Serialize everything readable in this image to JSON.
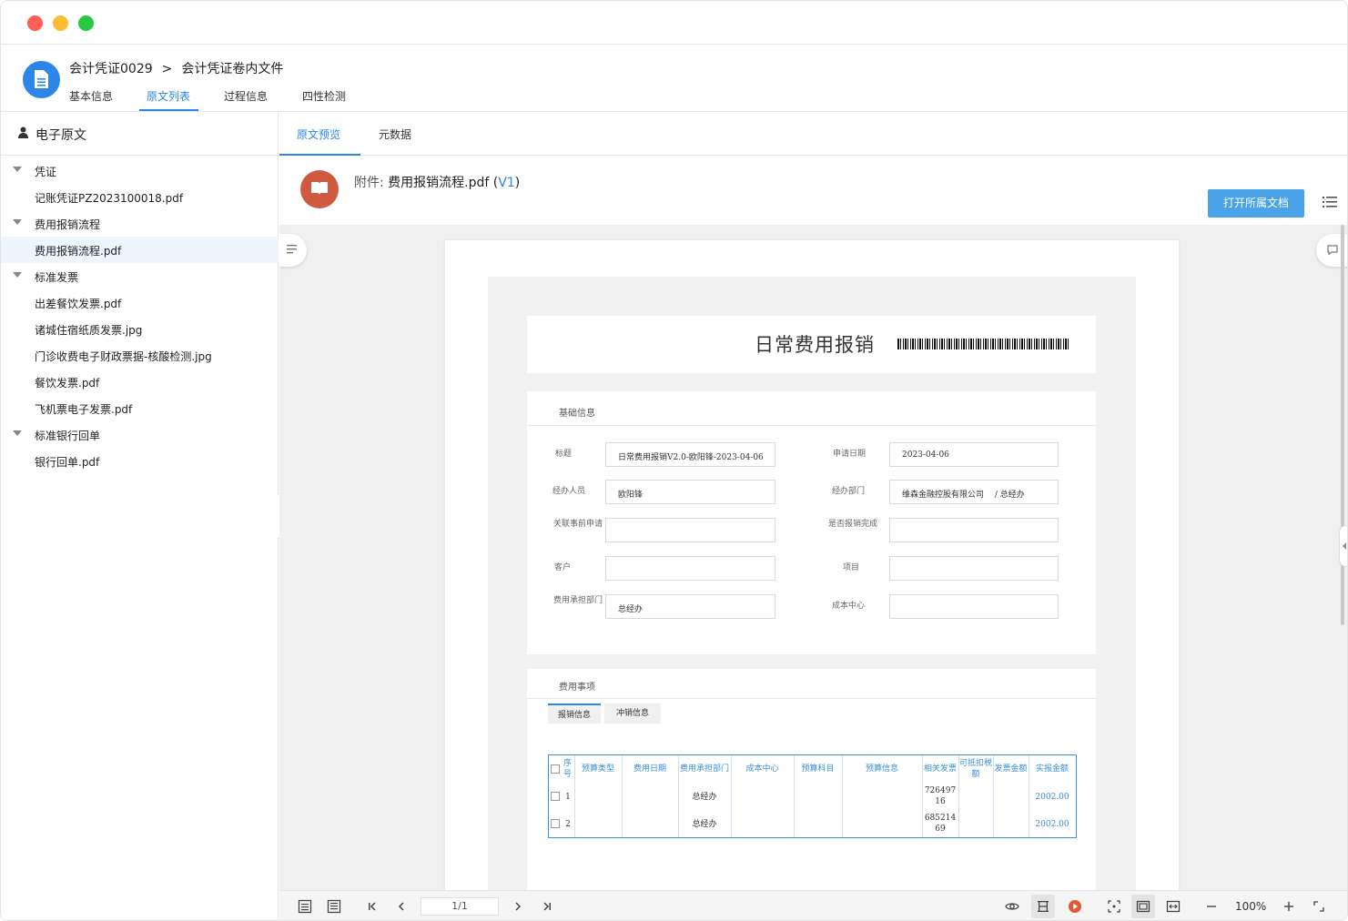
{
  "header": {
    "breadcrumb": [
      "会计凭证0029",
      ">",
      "会计凭证卷内文件"
    ],
    "tabs": [
      "基本信息",
      "原文列表",
      "过程信息",
      "四性检测"
    ],
    "active_tab": "原文列表"
  },
  "sidebar": {
    "title": "电子原文",
    "tree": [
      {
        "label": "凭证",
        "type": "group"
      },
      {
        "label": "记账凭证PZ2023100018.pdf",
        "type": "file"
      },
      {
        "label": "费用报销流程",
        "type": "group"
      },
      {
        "label": "费用报销流程.pdf",
        "type": "file",
        "selected": true
      },
      {
        "label": "标准发票",
        "type": "group"
      },
      {
        "label": "出差餐饮发票.pdf",
        "type": "file"
      },
      {
        "label": "诸城住宿纸质发票.jpg",
        "type": "file"
      },
      {
        "label": "门诊收费电子财政票据-核酸检测.jpg",
        "type": "file"
      },
      {
        "label": "餐饮发票.pdf",
        "type": "file"
      },
      {
        "label": "飞机票电子发票.pdf",
        "type": "file"
      },
      {
        "label": "标准银行回单",
        "type": "group"
      },
      {
        "label": "银行回单.pdf",
        "type": "file"
      }
    ]
  },
  "main": {
    "tabs": [
      "原文预览",
      "元数据"
    ],
    "active_tab": "原文预览",
    "attachment": {
      "prefix": "附件:",
      "name": "费用报销流程.pdf",
      "paren_open": " (",
      "version": "V1",
      "paren_close": ")"
    },
    "open_button": "打开所属文档"
  },
  "document": {
    "title": "日常费用报销",
    "basic_section": "基础信息",
    "fields": {
      "title_label": "标题",
      "title_value": "日常费用报销V2.0-欧阳锋-2023-04-06",
      "apply_date_label": "申请日期",
      "apply_date_value": "2023-04-06",
      "handler_label": "经办人员",
      "handler_value": "欧阳锋",
      "dept_label": "经办部门",
      "dept_value": "维森金融控股有限公司　 / 总经办",
      "pre_app_label": "关联事前申请",
      "reimb_done_label": "是否报销完成",
      "customer_label": "客户",
      "project_label": "项目",
      "bear_dept_label": "费用承担部门",
      "bear_dept_value": "总经办",
      "cost_center_label": "成本中心"
    },
    "expense_section": "费用事项",
    "sub_tabs": [
      "报销信息",
      "冲销信息"
    ],
    "table_headers": [
      "序号",
      "预算类型",
      "费用日期",
      "费用承担部门",
      "成本中心",
      "预算科目",
      "预算信息",
      "相关发票",
      "可抵扣税额",
      "发票金额",
      "实报金额"
    ],
    "rows": [
      {
        "no": "1",
        "dept": "总经办",
        "invoice": "72649716",
        "amount": "2002.00"
      },
      {
        "no": "2",
        "dept": "总经办",
        "invoice": "68521469",
        "amount": "2002.00"
      }
    ]
  },
  "toolbar": {
    "page": "1/1",
    "zoom": "100%"
  },
  "colors": {
    "accent": "#2b86e8",
    "attach_icon": "#d05a3f",
    "button": "#4aa3e8"
  }
}
